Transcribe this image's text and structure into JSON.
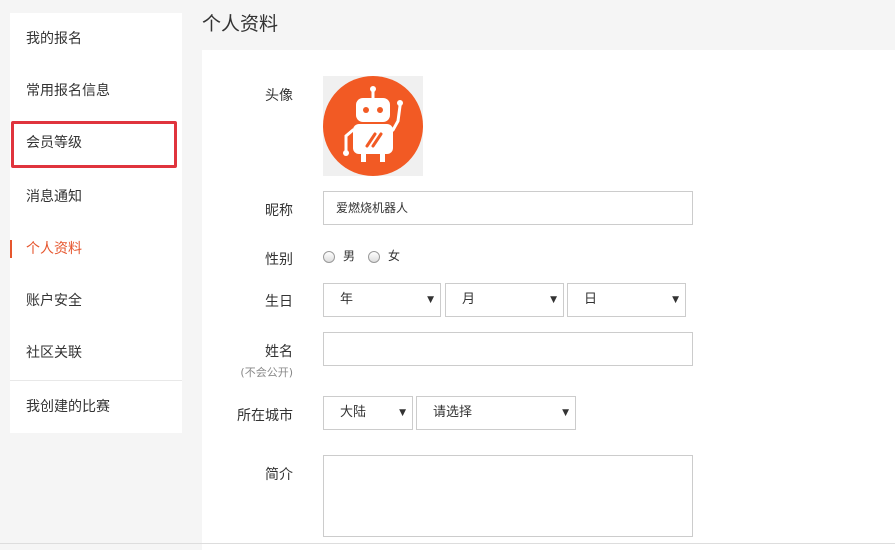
{
  "sidebar": {
    "items": [
      {
        "label": "我的报名"
      },
      {
        "label": "常用报名信息"
      },
      {
        "label": "会员等级"
      },
      {
        "label": "消息通知"
      },
      {
        "label": "个人资料"
      },
      {
        "label": "账户安全"
      },
      {
        "label": "社区关联"
      },
      {
        "label": "我创建的比赛"
      }
    ],
    "active_index": 4
  },
  "page": {
    "title": "个人资料"
  },
  "form": {
    "avatar_label": "头像",
    "avatar_icon": "robot-avatar",
    "nickname_label": "昵称",
    "nickname_value": "爱燃烧机器人",
    "gender_label": "性别",
    "gender_options": [
      "男",
      "女"
    ],
    "birthday_label": "生日",
    "birthday_year": "年",
    "birthday_month": "月",
    "birthday_day": "日",
    "name_label": "姓名",
    "name_note": "(不会公开)",
    "name_value": "",
    "city_label": "所在城市",
    "city_region": "大陆",
    "city_select": "请选择",
    "intro_label": "简介",
    "intro_value": ""
  },
  "colors": {
    "accent": "#e6562e",
    "highlight": "#e0343d",
    "avatar_bg": "#f25a24"
  }
}
